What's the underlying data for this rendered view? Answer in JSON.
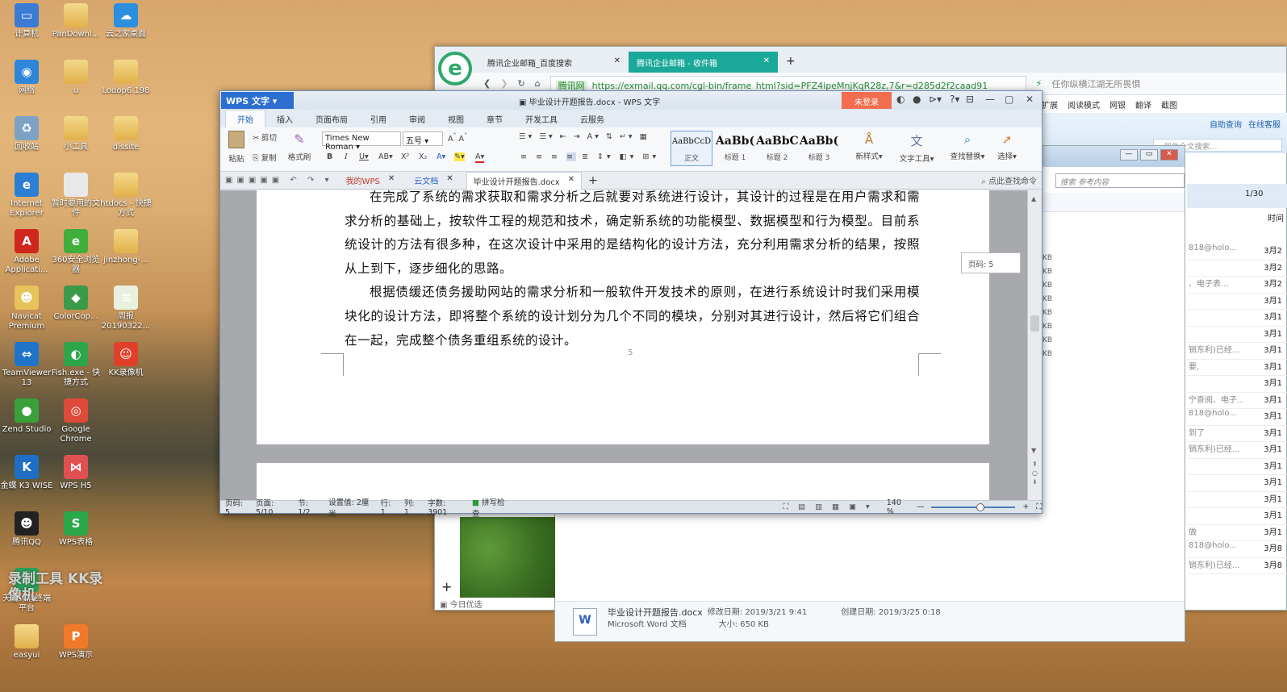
{
  "desktop": {
    "icons": [
      {
        "label": "计算机",
        "color": "#3b7bd4",
        "glyph": "▭"
      },
      {
        "label": "PanDownl...",
        "color": "folder",
        "glyph": ""
      },
      {
        "label": "云之家桌面",
        "color": "#2b8fe0",
        "glyph": "☁"
      },
      {
        "label": "网络",
        "color": "#2f86d8",
        "glyph": "◉"
      },
      {
        "label": "u",
        "color": "folder",
        "glyph": ""
      },
      {
        "label": "Lodop6.198",
        "color": "folder",
        "glyph": ""
      },
      {
        "label": "回收站",
        "color": "#7da2c4",
        "glyph": "♻"
      },
      {
        "label": "小工具",
        "color": "folder",
        "glyph": ""
      },
      {
        "label": "dissite",
        "color": "folder",
        "glyph": ""
      },
      {
        "label": "Internet Explorer",
        "color": "#2a7fd4",
        "glyph": "e"
      },
      {
        "label": "暂时要用的文件",
        "color": "#e8e8e8",
        "glyph": ""
      },
      {
        "label": "htdocs - 快捷方式",
        "color": "folder",
        "glyph": ""
      },
      {
        "label": "Adobe Applicati...",
        "color": "#d0261c",
        "glyph": "A"
      },
      {
        "label": "360安全浏览器",
        "color": "#3fae3a",
        "glyph": "e"
      },
      {
        "label": "jinzhong-...",
        "color": "folder",
        "glyph": ""
      },
      {
        "label": "Navicat Premium",
        "color": "#e8c25a",
        "glyph": "☻"
      },
      {
        "label": "ColorCop...",
        "color": "#3a9a4a",
        "glyph": "◆"
      },
      {
        "label": "周报 20190322...",
        "color": "#e8f0e0",
        "glyph": "≡"
      },
      {
        "label": "TeamViewer 13",
        "color": "#1f74c9",
        "glyph": "⇔"
      },
      {
        "label": "Fish.exe - 快捷方式",
        "color": "#2fa54a",
        "glyph": "◐"
      },
      {
        "label": "KK录像机",
        "color": "#e0402a",
        "glyph": "☺"
      },
      {
        "label": "Zend Studio",
        "color": "#3aa03a",
        "glyph": "●"
      },
      {
        "label": "Google Chrome",
        "color": "#dd4a3a",
        "glyph": "◎"
      },
      {
        "label": "",
        "color": "",
        "glyph": ""
      },
      {
        "label": "金蝶 K3 WISE",
        "color": "#1e6fc4",
        "glyph": "K"
      },
      {
        "label": "WPS H5",
        "color": "#e05050",
        "glyph": "⋈"
      },
      {
        "label": "",
        "color": "",
        "glyph": ""
      },
      {
        "label": "腾讯QQ",
        "color": "#222",
        "glyph": "☻"
      },
      {
        "label": "WPS表格",
        "color": "#2aa84a",
        "glyph": "S"
      },
      {
        "label": "",
        "color": "",
        "glyph": ""
      },
      {
        "label": "天锐绿盾终端平台",
        "color": "#2aa05a",
        "glyph": "✔"
      },
      {
        "label": "",
        "color": "",
        "glyph": ""
      },
      {
        "label": "",
        "color": "",
        "glyph": ""
      },
      {
        "label": "easyui",
        "color": "folder",
        "glyph": ""
      },
      {
        "label": "WPS演示",
        "color": "#f07a2a",
        "glyph": "P"
      }
    ],
    "watermark": "录制工具 KK录像机"
  },
  "browser": {
    "tabs": [
      {
        "label": "腾讯企业邮箱_百度搜索",
        "active": false
      },
      {
        "label": "腾讯企业邮箱 - 收件箱",
        "active": true
      }
    ],
    "site_badge": "腾讯网",
    "url": "https://exmail.qq.com/cgi-bin/frame_html?sid=PFZ4ipeMnjKqR28z,7&r=d285d2f2caad91",
    "search_hint": "任你纵横江湖无所畏惧",
    "toolbar": [
      "扩展",
      "阅读模式",
      "网银",
      "翻译",
      "截图"
    ],
    "links": [
      "自助查询",
      "在线客服"
    ],
    "search_placeholder": "邮件全文搜索...",
    "page_counter": "1/30",
    "time_header": "时间",
    "mail_dates": [
      "3月2",
      "3月2",
      "3月2",
      "3月1",
      "3月1",
      "3月1",
      "3月1",
      "3月1",
      "3月1",
      "3月1",
      "3月1",
      "3月1",
      "3月1",
      "3月1",
      "3月1",
      "3月1",
      "3月1",
      "3月1",
      "3月8",
      "3月8"
    ],
    "mail_senders": [
      "818@holo...",
      "",
      "、电子表...",
      "",
      "",
      "",
      "销东利)已经...",
      "要,",
      "",
      "宁查阅、电子...",
      "818@holo...",
      "到了",
      "销东利)已经...",
      "",
      "",
      "",
      "",
      "做",
      "818@holo...",
      "销东利)已经..."
    ],
    "today_label": "今日优选"
  },
  "explorer": {
    "search_placeholder": "搜索 参考内容",
    "sizes": [
      "KB",
      "KB",
      "KB",
      "KB",
      "KB",
      "KB",
      "KB",
      "KB"
    ],
    "file_name": "毕业设计开题报告.docx",
    "modified": "修改日期: 2019/3/21 9:41",
    "created": "创建日期: 2019/3/25 0:18",
    "file_type": "Microsoft Word 文档",
    "file_size": "大小: 650 KB"
  },
  "wps": {
    "logo": "WPS 文字",
    "title": "毕业设计开题报告.docx - WPS 文字",
    "login": "未登录",
    "menu_tabs": [
      "开始",
      "插入",
      "页面布局",
      "引用",
      "审阅",
      "视图",
      "章节",
      "开发工具",
      "云服务"
    ],
    "ribbon": {
      "paste": "粘贴",
      "cut": "剪切",
      "copy": "复制",
      "format_painter": "格式刷",
      "font": "Times New Roman",
      "size": "五号",
      "styles": [
        {
          "preview": "AaBbCcD",
          "name": "正文"
        },
        {
          "preview": "AaBb(",
          "name": "标题 1"
        },
        {
          "preview": "AaBbC",
          "name": "标题 2"
        },
        {
          "preview": "AaBb(",
          "name": "标题 3"
        }
      ],
      "new_style": "新样式",
      "text_tools": "文字工具",
      "find_replace": "查找替换",
      "select": "选择"
    },
    "doc_tabs": [
      "我的WPS",
      "云文档",
      "毕业设计开题报告.docx"
    ],
    "command_search": "点此查找命令",
    "paragraphs": [
      "在完成了系统的需求获取和需求分析之后就要对系统进行设计，其设计的过程是在用户需求和需求分析的基础上，按软件工程的规范和技术，确定新系统的功能模型、数据模型和行为模型。目前系统设计的方法有很多种，在这次设计中采用的是结构化的设计方法，充分利用需求分析的结果，按照从上到下，逐步细化的思路。",
      "根据债缓还债务援助网站的需求分析和一般软件开发技术的原则，在进行系统设计时我们采用模块化的设计方法，即将整个系统的设计划分为几个不同的模块，分别对其进行设计，然后将它们组合在一起，完成整个债务重组系统的设计。"
    ],
    "page_number": "5",
    "tooltip": "页码: 5",
    "status": {
      "page": "页码: 5",
      "pages": "页面: 5/10",
      "section": "节: 1/2",
      "setting": "设置值: 2厘米",
      "row": "行: 1",
      "col": "列: 1",
      "words": "字数: 3901",
      "spell": "拼写检查",
      "zoom": "140 %"
    }
  }
}
